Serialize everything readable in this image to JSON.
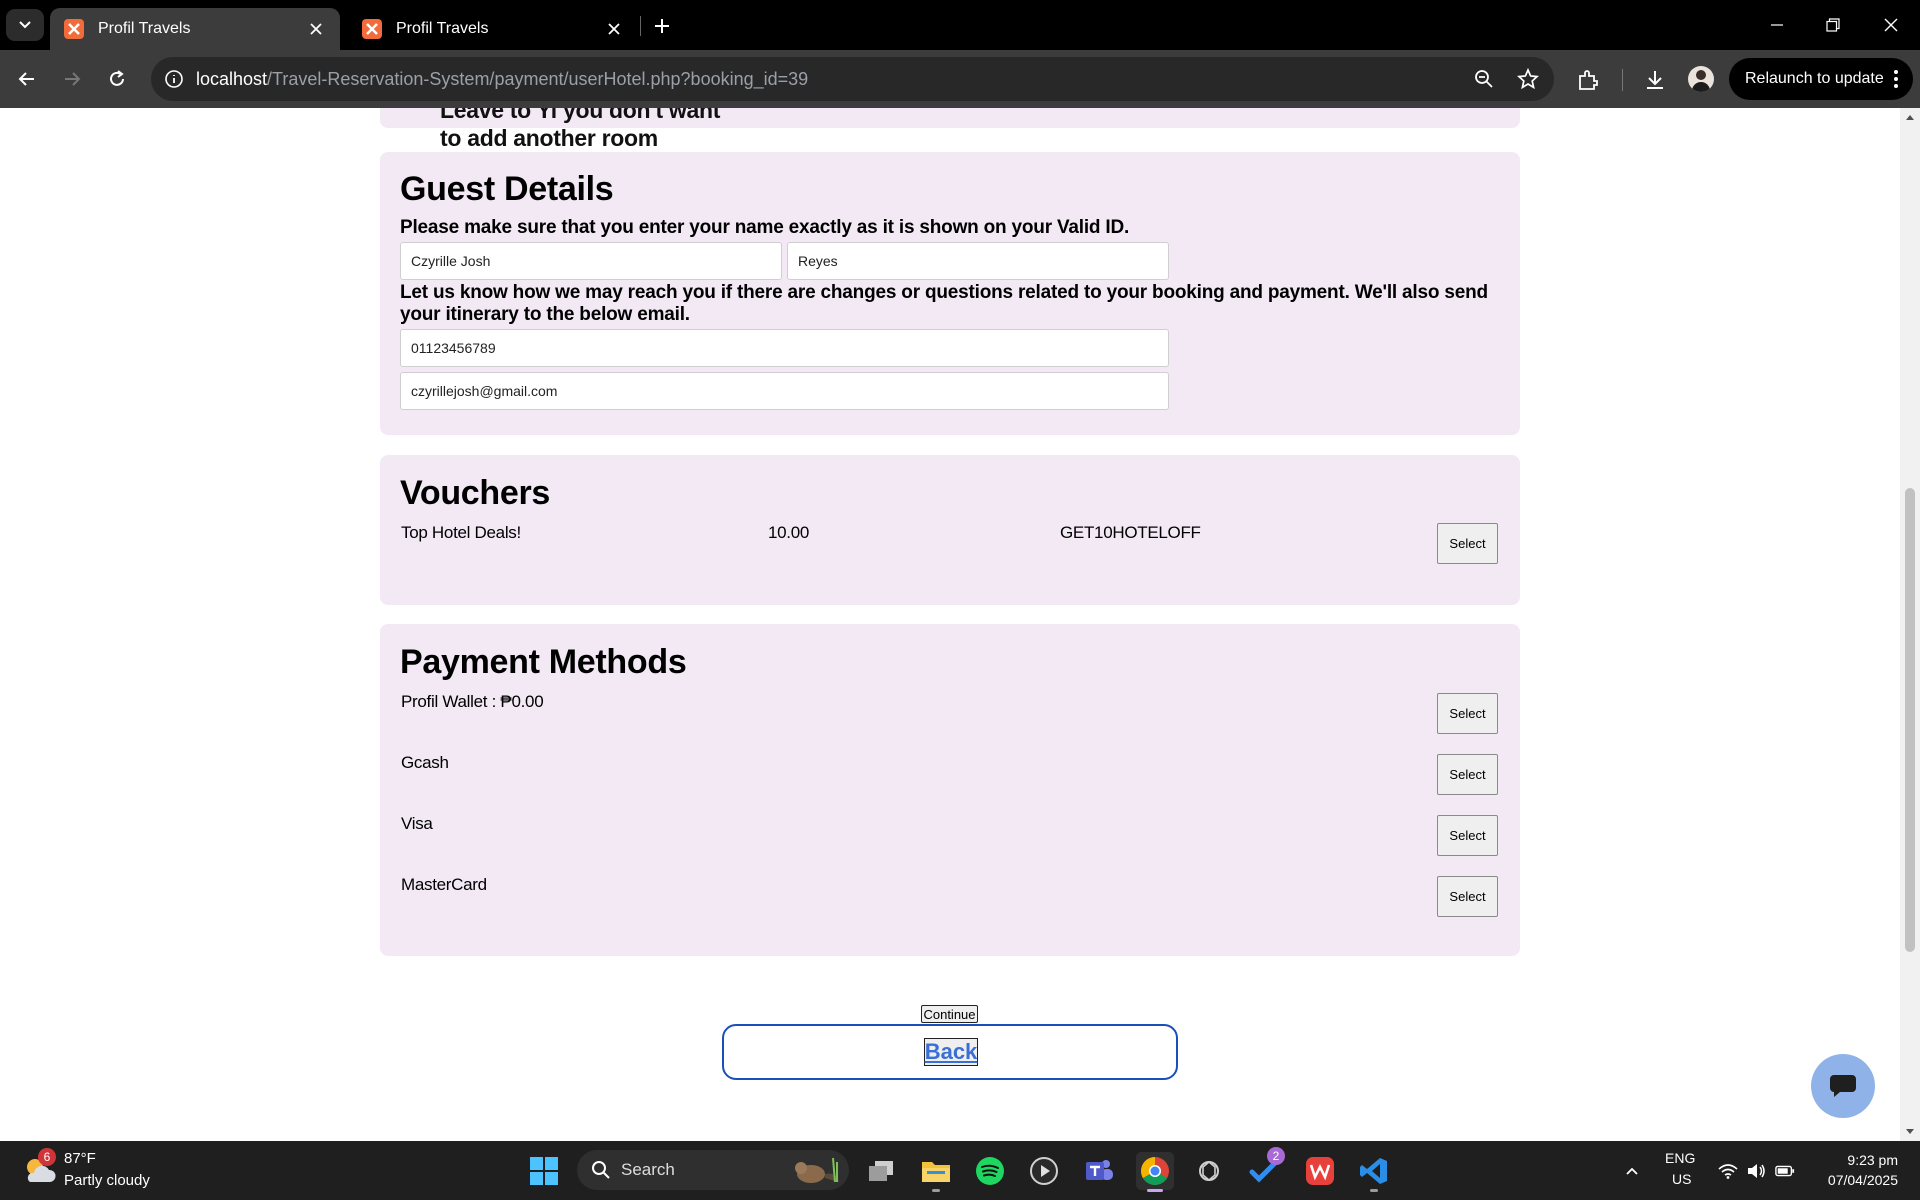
{
  "browser": {
    "tabs": [
      {
        "title": "Profil Travels",
        "active": true
      },
      {
        "title": "Profil Travels",
        "active": false
      }
    ],
    "url_host": "localhost",
    "url_path": "/Travel-Reservation-System/payment/userHotel.php?booking_id=39",
    "relaunch_label": "Relaunch to update"
  },
  "page": {
    "leftover_text": "Leave to Yi you don't want to add another room",
    "guest_details": {
      "title": "Guest Details",
      "name_note": "Please make sure that you enter your name exactly as it is shown on your Valid ID.",
      "first_name": "Czyrille Josh",
      "last_name": "Reyes",
      "contact_note": "Let us know how we may reach you if there are changes or questions related to your booking and payment. We'll also send your itinerary to the below email.",
      "phone": "01123456789",
      "email": "czyrillejosh@gmail.com"
    },
    "vouchers": {
      "title": "Vouchers",
      "items": [
        {
          "name": "Top Hotel Deals!",
          "amount": "10.00",
          "code": "GET10HOTELOFF",
          "button": "Select"
        }
      ]
    },
    "payment_methods": {
      "title": "Payment Methods",
      "items": [
        {
          "label": "Profil Wallet : ₱0.00",
          "button": "Select"
        },
        {
          "label": "Gcash",
          "button": "Select"
        },
        {
          "label": "Visa",
          "button": "Select"
        },
        {
          "label": "MasterCard",
          "button": "Select"
        }
      ]
    },
    "continue_label": "Continue",
    "back_label": "Back"
  },
  "taskbar": {
    "weather_badge": "6",
    "temperature": "87°F",
    "weather_desc": "Partly cloudy",
    "search_placeholder": "Search",
    "todo_badge": "2",
    "lang_line1": "ENG",
    "lang_line2": "US",
    "time": "9:23 pm",
    "date": "07/04/2025"
  },
  "colors": {
    "card_bg": "#f2e9f5",
    "back_border": "#1b4fb8",
    "chat_button": "#8fb3e8"
  }
}
